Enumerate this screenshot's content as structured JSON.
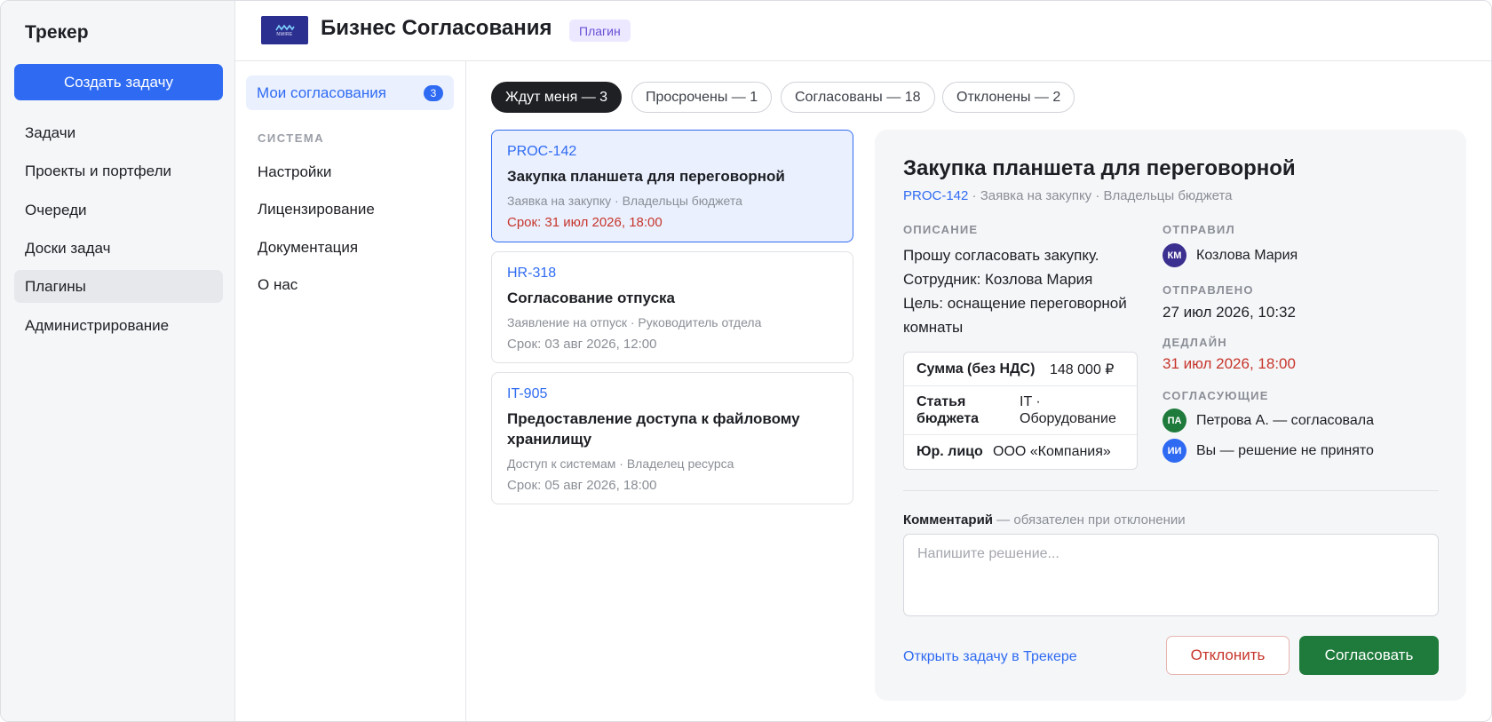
{
  "app": {
    "title": "Трекер",
    "create_button": "Создать задачу",
    "nav": [
      "Задачи",
      "Проекты и портфели",
      "Очереди",
      "Доски задач",
      "Плагины",
      "Администрирование"
    ],
    "active_nav": "Плагины"
  },
  "header": {
    "logo_text": "NWIRE",
    "title": "Бизнес Согласования",
    "badge": "Плагин"
  },
  "plugin_nav": {
    "my_approvals": {
      "label": "Мои согласования",
      "count": "3"
    },
    "section_label": "СИСТЕМА",
    "items": [
      "Настройки",
      "Лицензирование",
      "Документация",
      "О нас"
    ]
  },
  "filters": [
    {
      "label": "Ждут меня — 3",
      "active": true
    },
    {
      "label": "Просрочены — 1",
      "active": false
    },
    {
      "label": "Согласованы — 18",
      "active": false
    },
    {
      "label": "Отклонены — 2",
      "active": false
    }
  ],
  "requests": [
    {
      "id": "PROC-142",
      "title": "Закупка планшета для переговорной",
      "meta": "Заявка на закупку · Владельцы бюджета",
      "due": "Срок: 31 июл 2026, 18:00",
      "overdue": true,
      "selected": true
    },
    {
      "id": "HR-318",
      "title": "Согласование отпуска",
      "meta": "Заявление на отпуск · Руководитель отдела",
      "due": "Срок: 03 авг 2026, 12:00",
      "overdue": false,
      "selected": false
    },
    {
      "id": "IT-905",
      "title": "Предоставление доступа к файловому хранилищу",
      "meta": "Доступ к системам · Владелец ресурса",
      "due": "Срок: 05 авг 2026, 18:00",
      "overdue": false,
      "selected": false
    }
  ],
  "detail": {
    "title": "Закупка планшета для переговорной",
    "id": "PROC-142",
    "sub_rest": " · Заявка на закупку · Владельцы бюджета",
    "description_label": "ОПИСАНИЕ",
    "description_lines": [
      "Прошу согласовать закупку.",
      "Сотрудник: Козлова Мария",
      "Цель: оснащение переговорной",
      "комнаты"
    ],
    "fields": [
      {
        "key": "Сумма (без НДС)",
        "value": "148 000 ₽"
      },
      {
        "key": "Статья бюджета",
        "value": "IT · Оборудование"
      },
      {
        "key": "Юр. лицо",
        "value": "ООО «Компания»"
      }
    ],
    "sender_label": "ОТПРАВИЛ",
    "sender": {
      "initials": "КМ",
      "name": "Козлова Мария",
      "color": "#3b2f8f"
    },
    "sent_label": "ОТПРАВЛЕНО",
    "sent": "27 июл 2026, 10:32",
    "deadline_label": "ДЕДЛАЙН",
    "deadline": "31 июл 2026, 18:00",
    "approvers_label": "СОГЛАСУЮЩИЕ",
    "approvers": [
      {
        "initials": "ПА",
        "text": "Петрова А. — согласовала",
        "color": "#1e7b3b"
      },
      {
        "initials": "ИИ",
        "text": "Вы — решение не принято",
        "color": "#2f6bf2"
      }
    ],
    "comment_label": "Комментарий",
    "comment_hint": " — обязателен при отклонении",
    "comment_placeholder": "Напишите решение...",
    "open_link": "Открыть задачу в Трекере",
    "reject_button": "Отклонить",
    "approve_button": "Согласовать"
  },
  "colors": {
    "accent": "#2f6bf2",
    "danger": "#c7352b",
    "success": "#1e7b3b",
    "logo_bg": "#2b2f8f",
    "badge_bg": "#ece8ff",
    "badge_text": "#6a4fd6"
  }
}
